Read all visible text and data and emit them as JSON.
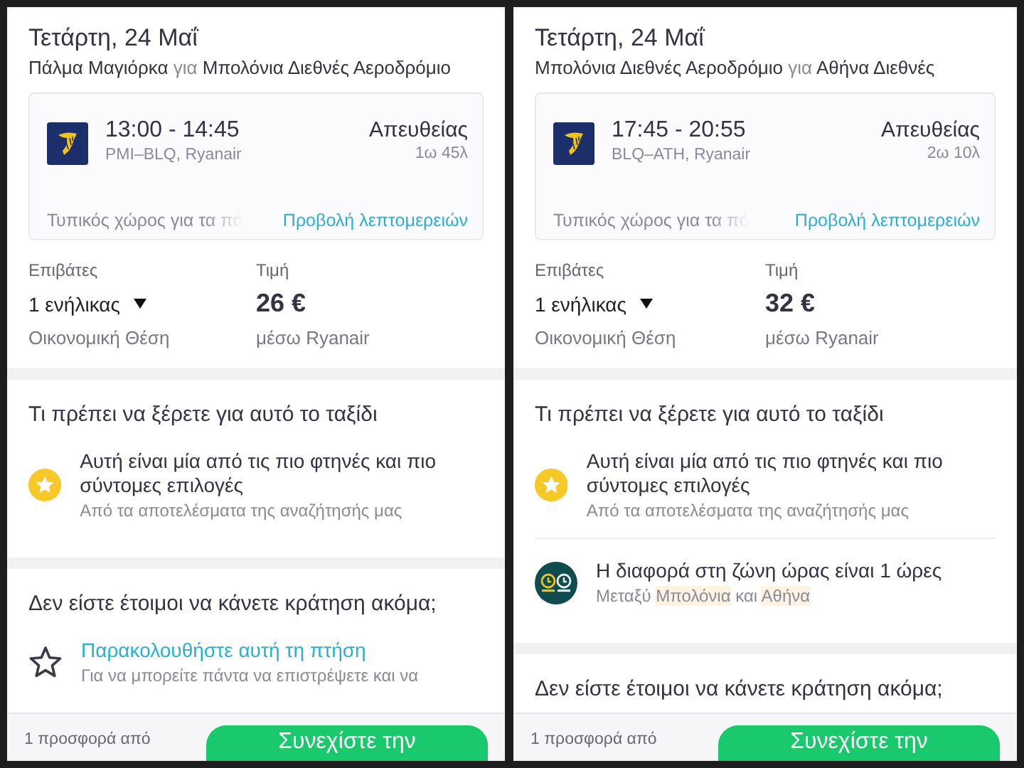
{
  "panels": [
    {
      "date": "Τετάρτη, 24 Μαΐ",
      "route": {
        "from": "Πάλμα Μαγιόρκα",
        "connector": "για",
        "to": "Μπολόνια Διεθνές Αεροδρόμιο"
      },
      "flight": {
        "times": "13:00 - 14:45",
        "details": "PMI–BLQ, Ryanair",
        "stops": "Απευθείας",
        "duration": "1ω 45λ",
        "baggage": "Τυπικός χώρος για τα πό",
        "details_link": "Προβολή λεπτομερειών"
      },
      "passengers": {
        "label": "Επιβάτες",
        "value": "1 ενήλικας",
        "cabin": "Οικονομική Θέση"
      },
      "price": {
        "label": "Τιμή",
        "value": "26 €",
        "via": "μέσω Ryanair"
      },
      "info": {
        "title": "Τι πρέπει να ξέρετε για αυτό το ταξίδι",
        "items": [
          {
            "kind": "cheap",
            "title": "Αυτή είναι μία από τις πιο φτηνές και πιο σύντομες επιλογές",
            "parts": [
              {
                "text": "Από τα αποτελέσματα της αναζήτησής μας",
                "highlighted": false
              }
            ]
          }
        ]
      },
      "not_ready": {
        "title": "Δεν είστε έτοιμοι να κάνετε κράτηση ακόμα;",
        "items": [
          {
            "kind": "watch",
            "title": "Παρακολουθήστε αυτή τη πτήση",
            "text": "Για να μπορείτε πάντα να επιστρέψετε και να"
          }
        ]
      },
      "footer": {
        "offer": "1 προσφορά από",
        "button": "Συνεχίστε την"
      }
    },
    {
      "date": "Τετάρτη, 24 Μαΐ",
      "route": {
        "from": "Μπολόνια Διεθνές Αεροδρόμιο",
        "connector": "για",
        "to": "Αθήνα Διεθνές"
      },
      "flight": {
        "times": "17:45 - 20:55",
        "details": "BLQ–ATH, Ryanair",
        "stops": "Απευθείας",
        "duration": "2ω 10λ",
        "baggage": "Τυπικός χώρος για τα πό",
        "details_link": "Προβολή λεπτομερειών"
      },
      "passengers": {
        "label": "Επιβάτες",
        "value": "1 ενήλικας",
        "cabin": "Οικονομική Θέση"
      },
      "price": {
        "label": "Τιμή",
        "value": "32 €",
        "via": "μέσω Ryanair"
      },
      "info": {
        "title": "Τι πρέπει να ξέρετε για αυτό το ταξίδι",
        "items": [
          {
            "kind": "cheap",
            "title": "Αυτή είναι μία από τις πιο φτηνές και πιο σύντομες επιλογές",
            "parts": [
              {
                "text": "Από τα αποτελέσματα της αναζήτησής μας",
                "highlighted": false
              }
            ]
          },
          {
            "kind": "timezone",
            "title": "Η διαφορά στη ζώνη ώρας είναι 1 ώρες",
            "parts": [
              {
                "text": "Μεταξύ",
                "highlighted": false
              },
              {
                "text": "Μπολόνια",
                "highlighted": true
              },
              {
                "text": "και",
                "highlighted": false
              },
              {
                "text": "Αθήνα",
                "highlighted": true
              }
            ]
          }
        ]
      },
      "not_ready": {
        "title": "Δεν είστε έτοιμοι να κάνετε κράτηση ακόμα;"
      },
      "footer": {
        "offer": "1 προσφορά από",
        "button": "Συνεχίστε την"
      }
    }
  ]
}
